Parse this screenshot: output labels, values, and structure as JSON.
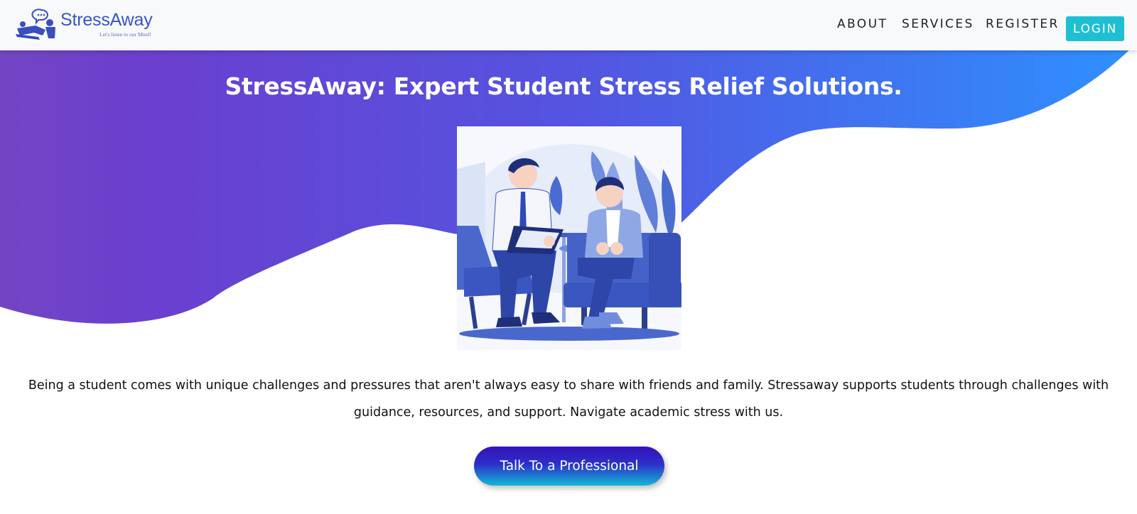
{
  "brand": {
    "name": "StressAway",
    "tagline": "Let's listen to our Mind!",
    "logo_icon": "counseling-chat-icon",
    "color": "#3655c8"
  },
  "nav": {
    "links": [
      "ABOUT",
      "SERVICES",
      "REGISTER"
    ],
    "login_label": "LOGIN",
    "login_color": "#1ebfd2"
  },
  "hero": {
    "title": "StressAway: Expert Student Stress Relief Solutions.",
    "illustration": "counselor-and-student-illustration",
    "gradient": [
      "#7040c8",
      "#5555e0",
      "#2e90ff"
    ],
    "description": "Being a student comes with unique challenges and pressures that aren't always easy to share with friends and family. Stressaway supports students through challenges with guidance, resources, and support. Navigate academic stress with us.",
    "cta_label": "Talk To a Professional",
    "cta_colors": [
      "#3512b8",
      "#14b8d4"
    ]
  }
}
